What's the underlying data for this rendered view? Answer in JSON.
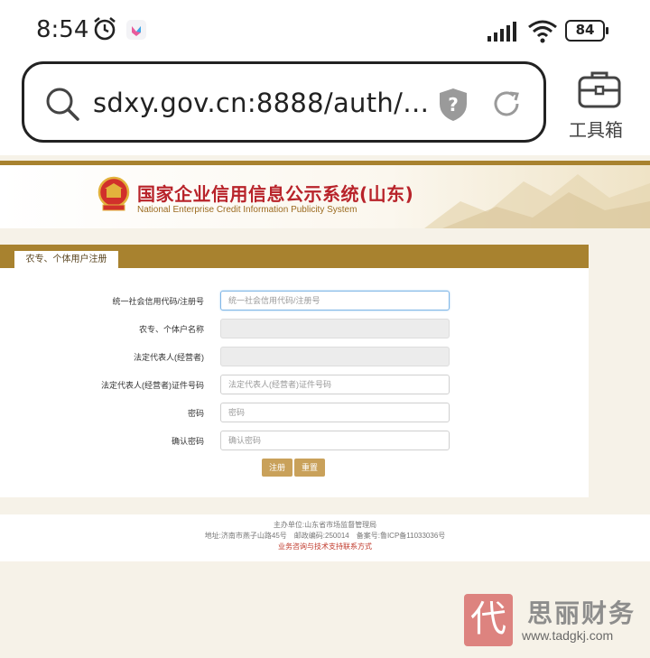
{
  "status_bar": {
    "time": "8:54",
    "battery": "84"
  },
  "browser": {
    "url": "sdxy.gov.cn:8888/auth/…",
    "toolbox_label": "工具箱"
  },
  "site_header": {
    "title_cn": "国家企业信用信息公示系统(山东)",
    "title_en": "National Enterprise Credit Information Publicity System"
  },
  "form": {
    "tab_label": "农专、个体用户注册",
    "rows": [
      {
        "label": "统一社会信用代码/注册号",
        "placeholder": "统一社会信用代码/注册号"
      },
      {
        "label": "农专、个体户名称",
        "placeholder": ""
      },
      {
        "label": "法定代表人(经营者)",
        "placeholder": ""
      },
      {
        "label": "法定代表人(经营者)证件号码",
        "placeholder": "法定代表人(经营者)证件号码"
      },
      {
        "label": "密码",
        "placeholder": "密码"
      },
      {
        "label": "确认密码",
        "placeholder": "确认密码"
      }
    ],
    "register_label": "注册",
    "reset_label": "重置"
  },
  "footer": {
    "line1": "主办单位:山东省市场监督管理局",
    "line2": "地址:济南市燕子山路45号　邮政编码:250014　备案号:鲁ICP备11033036号",
    "line3": "业务咨询与技术支持联系方式"
  },
  "watermark": {
    "seal_char": "代",
    "brand": "思丽财务",
    "url": "www.tadgkj.com"
  },
  "colors": {
    "accent_gold": "#a8822f",
    "button_gold": "#c9a15a",
    "title_red": "#b8232a"
  }
}
